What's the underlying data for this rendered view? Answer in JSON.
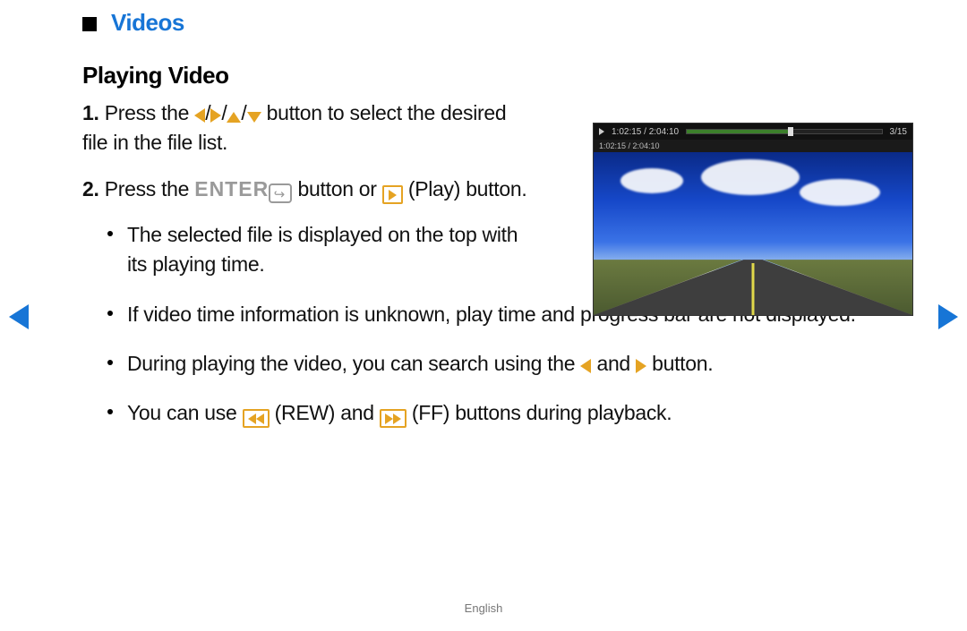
{
  "section_title": "Videos",
  "subheading": "Playing Video",
  "step1": {
    "prefix": "Press the ",
    "suffix": " button to select the desired file in the file list."
  },
  "step2": {
    "prefix": "Press the ",
    "enter_label": "ENTER",
    "mid": " button or ",
    "play_label": " (Play) button."
  },
  "sub_bullets": {
    "b1": "The selected file is displayed on the top with its playing time.",
    "b2": "If video time information is unknown, play time and progress bar are not displayed.",
    "b3_prefix": "During playing the video, you can search using the ",
    "b3_mid": " and ",
    "b3_suffix": " button.",
    "b4_prefix": "You can use ",
    "b4_rew": " (REW) and ",
    "b4_ff": " (FF) buttons during playback."
  },
  "player": {
    "time_top": "1:02:15 / 2:04:10",
    "count": "3/15",
    "time_sub": "1:02:15 / 2:04:10"
  },
  "footer_lang": "English",
  "numbers": {
    "one": "1.",
    "two": "2."
  }
}
